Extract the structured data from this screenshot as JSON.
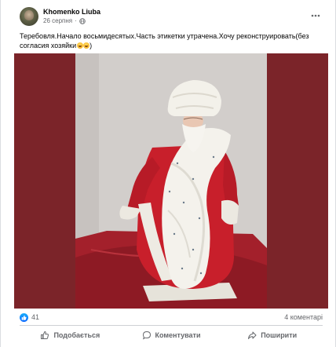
{
  "post": {
    "author": "Khomenko Liuba",
    "date": "26 серпня",
    "date_separator": "·",
    "caption": "Теребовля.Начало восьмидесятых.Часть этикетки утрачена.Хочу реконструировать(без согласия хозяйки",
    "caption_end": ")",
    "emojis": [
      "grinning-face",
      "grinning-face"
    ],
    "icons": {
      "avatar": "profile-photo",
      "privacy": "globe-icon",
      "menu": "more-horizontal-icon"
    },
    "photo": {
      "subject": "vintage Ded Moroz figure in red coat with white fur trim",
      "frame_color": "#7b2429"
    }
  },
  "reactions": {
    "like_count": "41",
    "comments_label": "4 коментарі"
  },
  "actions": {
    "like": "Подобається",
    "comment": "Коментувати",
    "share": "Поширити"
  },
  "colors": {
    "brand": "#0866ff",
    "muted_text": "#65676b",
    "divider": "#ced0d4"
  }
}
